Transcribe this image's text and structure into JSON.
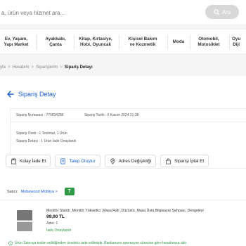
{
  "search": {
    "placeholder": "a, ürün veya hizmet ara...",
    "button_label": "Ara"
  },
  "categories": [
    {
      "line1": "Ev, Yaşam,",
      "line2": "Yapı Market"
    },
    {
      "line1": "Ayakkabı,",
      "line2": "Çanta"
    },
    {
      "line1": "Kitap, Kırtasiye,",
      "line2": "Hobi, Oyuncak"
    },
    {
      "line1": "Kişisel Bakım",
      "line2": "ve Kozmetik"
    },
    {
      "line1": "Moda",
      "line2": ""
    },
    {
      "line1": "Otomobil,",
      "line2": "Motosiklet"
    },
    {
      "line1": "Oyu",
      "line2": "Diji"
    }
  ],
  "breadcrumb": {
    "items": [
      "yfa",
      "Hesabım",
      "Siparişlerim",
      "Sipariş Detayı"
    ],
    "separator": ">"
  },
  "page": {
    "title": "Sipariş Detay"
  },
  "order": {
    "number_label": "Sipariş Numarası :",
    "number_value": "779034286",
    "date_label": "Sipariş Tarihi :",
    "date_value": "6 Kasım 2024 21:38",
    "summary": "Sipariş Özeti : 1 Teslimat, 1 Ürün",
    "detail": "Sipariş Detayı : 1 Ürün İade Onaylandı"
  },
  "actions": [
    {
      "label": "Kolay İade Et",
      "icon": "return-box-icon"
    },
    {
      "label": "Talep Oluştur",
      "icon": "document-icon"
    },
    {
      "label": "Adres Değişikliği",
      "icon": "location-pin-icon"
    },
    {
      "label": "Siparişi İptal Et",
      "icon": "bag-icon"
    }
  ],
  "seller": {
    "label": "Satıcı:",
    "name": "Mobawood Mobilya >",
    "score": "7"
  },
  "product": {
    "title": "Monitör Standı ,Monitör Yükseltici ,Masa Rafı ,Düzüstü ,Masa Üstü,Bilgisayar Sehpası, Dengeleyi",
    "price": "99,00 TL",
    "quantity": "Adet: 1",
    "status": "İade Onaylandı"
  },
  "notice": {
    "text": "Ürün Satıcıya teslim edildiğinden ücretiniz iade edilmiştir. Bankanızın operasyon süresine göre hesabınıza aktı"
  },
  "colors": {
    "accent_blue": "#1a5fd6",
    "success_green": "#2e9a45",
    "background": "#f5f5f5"
  }
}
